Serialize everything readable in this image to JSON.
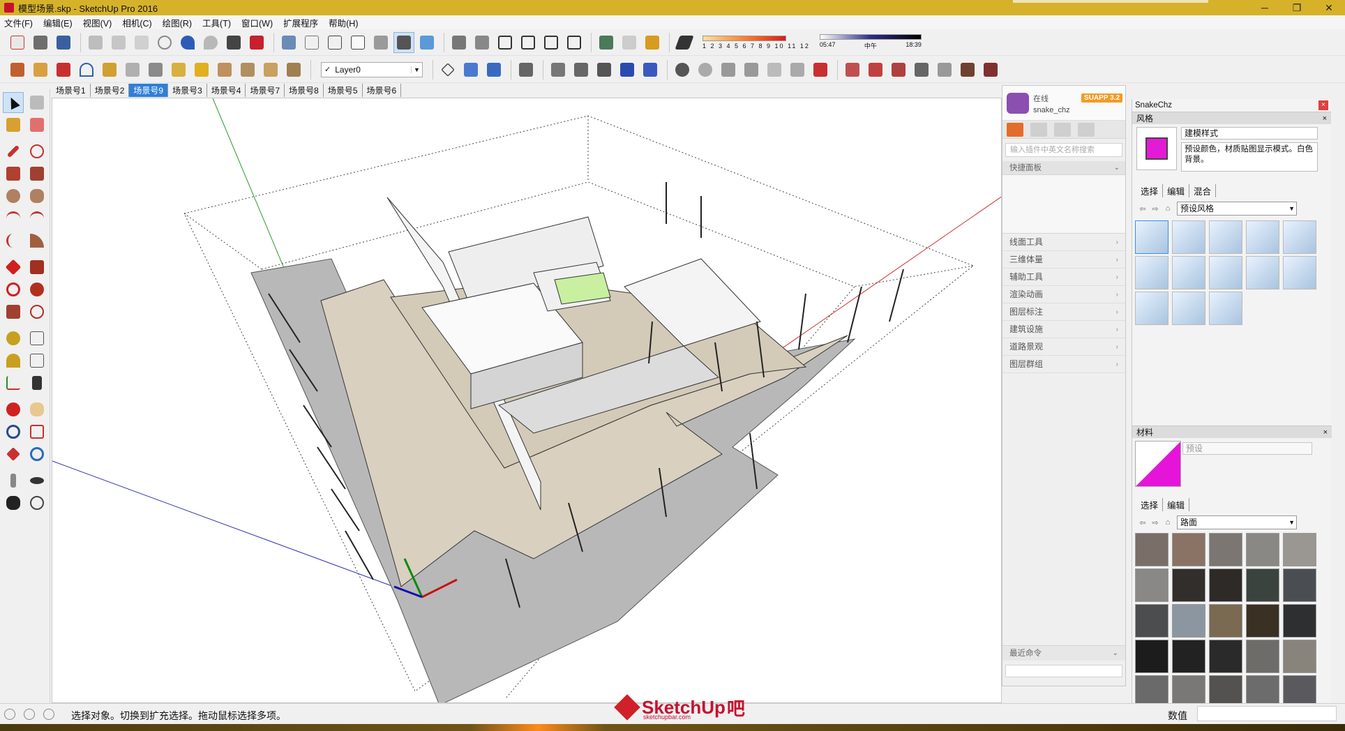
{
  "window": {
    "title": "模型场景.skp - SketchUp Pro 2016",
    "controls": [
      "─",
      "❐",
      "✕"
    ]
  },
  "menu": [
    "文件(F)",
    "编辑(E)",
    "视图(V)",
    "相机(C)",
    "绘图(R)",
    "工具(T)",
    "窗口(W)",
    "扩展程序",
    "帮助(H)"
  ],
  "toolbar": {
    "shadow_scale": "1 2 3 4 5 6 7 8 9 10 11 12",
    "time_start": "05:47",
    "time_mid": "中午",
    "time_end": "18:39",
    "layer_check": "✓",
    "layer_name": "Layer0"
  },
  "scenes": {
    "tabs": [
      "场景号1",
      "场景号2",
      "场景号9",
      "场景号3",
      "场景号4",
      "场景号7",
      "场景号8",
      "场景号5",
      "场景号6"
    ],
    "active_index": 2
  },
  "plugin": {
    "status": "在线",
    "user": "snake_chz",
    "badge": "SUAPP 3.2",
    "search_placeholder": "输入插件中英文名称搜索",
    "quick_panel": "快捷面板",
    "categories": [
      "线面工具",
      "三维体量",
      "辅助工具",
      "渲染动画",
      "图层标注",
      "建筑设施",
      "道路景观",
      "图层群组"
    ],
    "recent": "最近命令"
  },
  "tray": {
    "title": "SnakeChz",
    "styles": {
      "header": "风格",
      "name": "建模样式",
      "description": "预设颜色，材质贴图显示模式。白色背景。",
      "tabs": [
        "选择",
        "编辑",
        "混合"
      ],
      "collection": "预设风格"
    },
    "materials": {
      "header": "材料",
      "name_placeholder": "预设",
      "tabs": [
        "选择",
        "编辑"
      ],
      "collection": "路面",
      "swatches": [
        "#7a6e68",
        "#8a7264",
        "#7b7672",
        "#8a8884",
        "#9a9792",
        "#8a8886",
        "#322e2c",
        "#2e2a28",
        "#3b433e",
        "#4a4e52",
        "#4b4d4e",
        "#8c96a0",
        "#7a6a52",
        "#3a3024",
        "#2e2f31",
        "#1c1c1c",
        "#222222",
        "#2a2a2a",
        "#6e6c68",
        "#88847c",
        "#6a6a6a",
        "#7a7876",
        "#545250",
        "#6c6c6c",
        "#5a5a5e"
      ]
    }
  },
  "status": {
    "message": "选择对象。切换到扩充选择。拖动鼠标选择多项。",
    "value_label": "数值",
    "value": ""
  },
  "logo": {
    "text": "SketchUp",
    "suffix": "吧",
    "url": "sketchupbar.com"
  }
}
